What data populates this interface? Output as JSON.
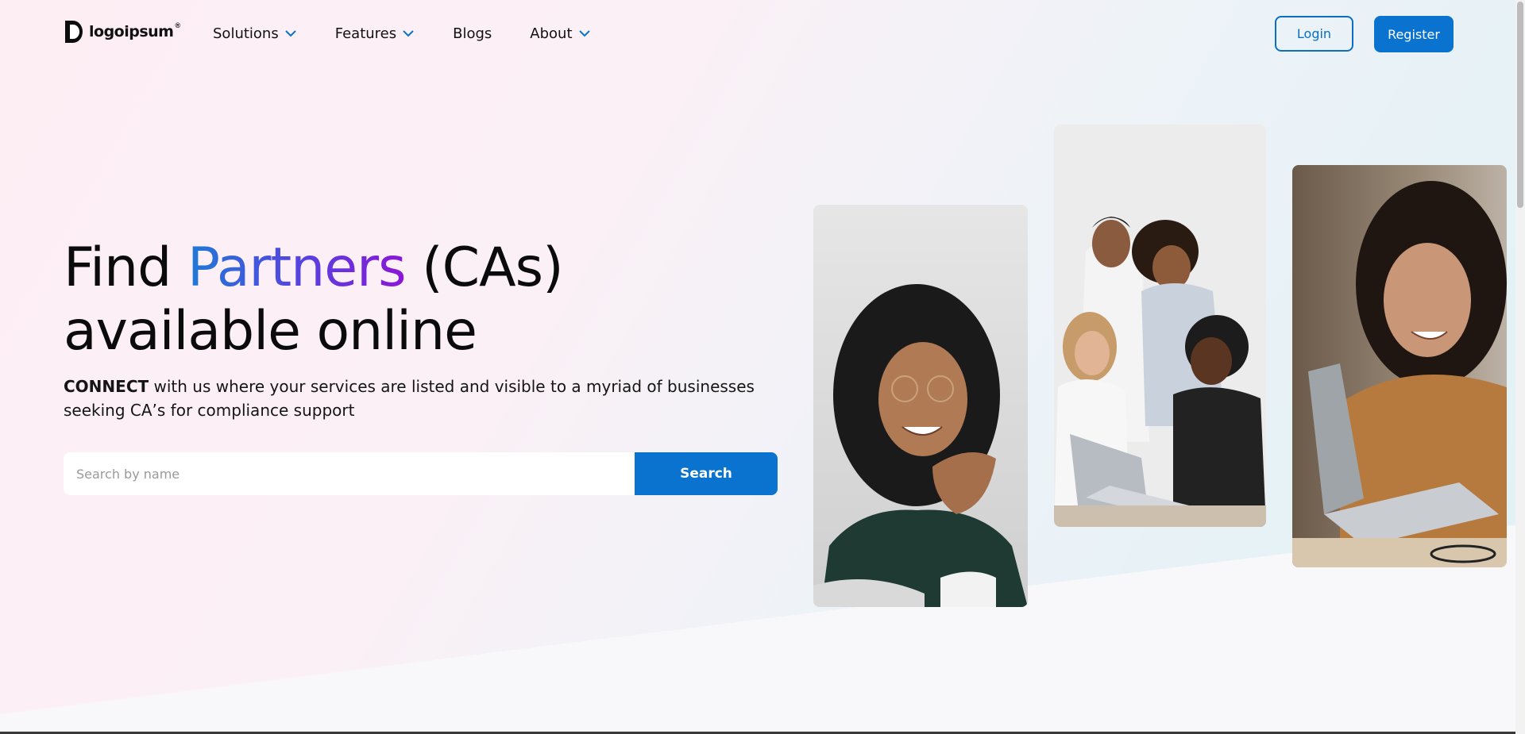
{
  "brand": {
    "name": "logoipsum",
    "reg_mark": "®",
    "logo_icon": "logo-mark-icon"
  },
  "nav": {
    "items": [
      {
        "label": "Solutions",
        "has_dropdown": true
      },
      {
        "label": "Features",
        "has_dropdown": true
      },
      {
        "label": "Blogs",
        "has_dropdown": false
      },
      {
        "label": "About",
        "has_dropdown": true
      }
    ],
    "login_label": "Login",
    "register_label": "Register"
  },
  "hero": {
    "headline_part1": "Find ",
    "headline_accent": "Partners",
    "headline_part2": " (CAs)",
    "headline_line2": "available online",
    "sub_lead": "CONNECT",
    "sub_rest": " with us where your services are listed and visible to a myriad of businesses seeking CA’s for compliance support"
  },
  "search": {
    "placeholder": "Search by name",
    "value": "",
    "button_label": "Search"
  },
  "images": [
    {
      "name": "woman-curly-hair-photo"
    },
    {
      "name": "team-meeting-laptop-photo"
    },
    {
      "name": "woman-laptop-photo"
    }
  ],
  "colors": {
    "primary": "#0a72cf",
    "accent_start": "#1f7ad6",
    "accent_end": "#8a16d6"
  }
}
